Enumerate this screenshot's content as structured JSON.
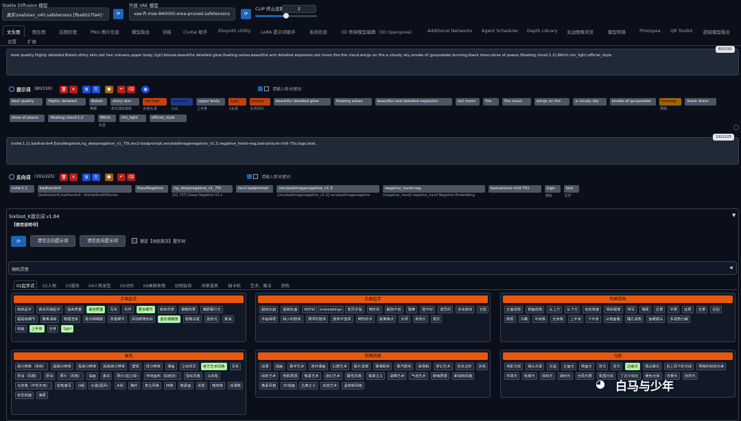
{
  "model": {
    "label": "Stable Diffusion 模型",
    "value": "真实\\realisian_v40.safetensors [fba9027fa4]",
    "vae_label": "外挂 VAE 模型",
    "vae_value": "vae-ft-mse-840000-ema-pruned.safetensors",
    "clip_label": "CLIP 终止层数",
    "clip_value": "2",
    "clip_level": 0.5
  },
  "tabs_row1": [
    "文生图",
    "图生图",
    "后期处理",
    "PNG 图片信息",
    "模型融合",
    "训练",
    "Civitai 助手",
    "Ebsynth Utility",
    "LoRA 提示词助手",
    "系统信息",
    "3D 骨架模型编辑（3D Openpose）",
    "Additional Networks",
    "Agent Scheduler",
    "Depth Library",
    "无边图像浏览",
    "模型转换",
    "Photopea",
    "QR Toolkit",
    "超级模型融合"
  ],
  "tabs_row2": [
    "设置",
    "扩展"
  ],
  "positive": {
    "text": "best quality,Highly detailed,Bokeh,shiny skin,red hair,volcano,upper body,1girl,blouse,beautiful detailed glow,floating ashes,beautiful and detailed explosion,red moon,fire,fire cloud,wings on fire,a cloudy sky,smoke of gunpowder,burning,black dress,dove of peace,(floating cloud:1.2),Witch,rim_light,official_style,",
    "counter": "80/150",
    "label": "提示词",
    "count": "(80/150)",
    "input_placeholder": "请输入新关键词",
    "chips": [
      {
        "t": "best quality",
        "s": ""
      },
      {
        "t": "Highly detailed",
        "s": ""
      },
      {
        "t": "Bokeh",
        "s": "焦散"
      },
      {
        "t": "shiny skin",
        "s": "有光泽的皮肤"
      },
      {
        "t": "red hair",
        "s": "红色头发"
      },
      {
        "t": "volcano",
        "s": "火山"
      },
      {
        "t": "upper body",
        "s": "上半身"
      },
      {
        "t": "1girl",
        "s": "1女孩"
      },
      {
        "t": "blouse",
        "s": "女式衬衫"
      },
      {
        "t": "beautiful detailed glow",
        "s": ""
      },
      {
        "t": "floating ashes",
        "s": ""
      },
      {
        "t": "beautiful and detailed explosion",
        "s": ""
      },
      {
        "t": "red moon",
        "s": ""
      },
      {
        "t": "fire",
        "s": ""
      },
      {
        "t": "fire cloud",
        "s": ""
      },
      {
        "t": "wings on fire",
        "s": ""
      },
      {
        "t": "a cloudy sky",
        "s": ""
      },
      {
        "t": "smoke of gunpowder",
        "s": ""
      },
      {
        "t": "burning",
        "s": "燃烧"
      },
      {
        "t": "black dress",
        "s": ""
      },
      {
        "t": "dove of peace",
        "s": ""
      },
      {
        "t": "floating cloud:1.2",
        "s": ""
      },
      {
        "t": "Witch",
        "s": "女巫"
      },
      {
        "t": "rim_light",
        "s": ""
      },
      {
        "t": "official_style",
        "s": ""
      }
    ]
  },
  "negative": {
    "text": "(nsfw:1.1),badhandv4,EasyNegative,ng_deepnegative_v1_75t,rev2-badprompt,verybadimagenegative_v1.3,negative_hand-neg,bad-picture-chill-75v,logo,text,",
    "counter": "191/225",
    "label": "反向词",
    "count": "(191/225)",
    "input_placeholder": "请输入新关键词",
    "chips": [
      {
        "t": "nsfw:1.1",
        "s": ""
      },
      {
        "t": "badhandv4",
        "s": "[badhandv4] badhandv4 - AnimeIllustDiffusion"
      },
      {
        "t": "EasyNegative",
        "s": ""
      },
      {
        "t": "ng_deepnegative_v1_75t",
        "s": "[V1.75T] Deep Negative V1.x"
      },
      {
        "t": "rev2-badprompt",
        "s": ""
      },
      {
        "t": "verybadimagenegative_v1.3",
        "s": "[verybadimagenegative_v1.3] verybadimagenegative"
      },
      {
        "t": "negative_hand-neg",
        "s": "[negative_hand] negative_hand Negative Embedding"
      },
      {
        "t": "bad-picture-chill-75v",
        "s": ""
      },
      {
        "t": "logo",
        "s": "商标"
      },
      {
        "t": "text",
        "s": "文字"
      }
    ]
  },
  "sixgod": {
    "title": "SixGod_K提示词 v1.64",
    "help": "【使用说明书】",
    "clear_pos": "清空正向提示词",
    "clear_neg": "清空反向提示词",
    "lock_label": "锁定【动态批次】提示词",
    "random_label": "随机灵感",
    "subtabs": [
      "01起手式",
      "02人物",
      "03服饰",
      "04人物发型",
      "05动作",
      "06画面表情",
      "动物装饰",
      "场景道具",
      "抽卡机",
      "艺术、魔法",
      "颜色"
    ],
    "groups": [
      {
        "title": "正面起手",
        "items": [
          "简单起手",
          "真实风格起手",
          "提高质量",
          "最佳质量",
          "写实",
          "杰作",
          "更多细节",
          "简单背景",
          "模糊背景",
          "满屏幕灯光",
          "超超级细节",
          "聚焦清晰",
          "物理渲染",
          "极详细细腻",
          "改善细节",
          "添加鲜艳色彩",
          "虚化模糊景",
          "粗略设置",
          "金粉光",
          "紫油",
          "绘画",
          "上半身",
          "全身",
          "1girl"
        ]
      },
      {
        "title": "负面起手",
        "items": [
          "超级负面",
          "基础负面",
          "NSFW",
          "embeddings",
          "变异手指",
          "畸形的",
          "解剖不良",
          "警察",
          "脸不好",
          "变异的",
          "多余肢体",
          "丑陋",
          "手画得很",
          "缺少的肢体",
          "漂浮的肢体",
          "肢体不连贯",
          "畸形的手",
          "脱离焦点",
          "长颈",
          "身体长",
          "变形"
        ]
      },
      {
        "title": "构图视角",
        "items": [
          "正面视角",
          "侧面视角",
          "从上方",
          "从下方",
          "动态角度",
          "倾斜视角",
          "特写",
          "微距",
          "近景",
          "中景",
          "远景",
          "全景",
          "近拍",
          "俯视",
          "鸟瞰",
          "半身像",
          "全身像",
          "上半身",
          "下半身",
          "从侧面看",
          "瞳孔视角",
          "鱼眼镜头",
          "多视角分解"
        ]
      },
      {
        "title": "画风",
        "items": [
          "高分辨率（常用）",
          "超高分辨率",
          "极高分辨率",
          "超高高分辨率",
          "壁纸",
          "低分辨率",
          "漫画",
          "立绘样式",
          "官方艺术风格",
          "写实",
          "厚涂（风格）",
          "厚涂",
          "照片（风格）",
          "油画",
          "真实",
          "照片(拍立得)",
          "传统画布（如纸张）",
          "签绘风格",
          "马克笔",
          "马克笔（中性灰色）",
          "铅笔速写",
          "Q版",
          "水墨(国风)",
          "水彩",
          "胸衬",
          "复古风格",
          "四格",
          "像素画",
          "彩影",
          "暗夜像",
          "动漫像",
          "杂志封面",
          "海报"
        ]
      },
      {
        "title": "构图风格",
        "items": [
          "动漫",
          "插画",
          "数字艺术",
          "连环漫画",
          "幻想艺术",
          "胶片滤镜",
          "赛博朋克",
          "蒸汽朋克",
          "高饱和",
          "梦幻艺术",
          "低多边形",
          "折纸",
          "线条艺术",
          "电影质感",
          "像素艺术",
          "迷幻艺术",
          "酸性风格",
          "极简主义",
          "故障艺术",
          "气泡艺术",
          "玻璃质感",
          "新拟物风格",
          "像素风格",
          "3D插画",
          "古典主义",
          "动态艺术",
          "孟菲斯风格"
        ]
      },
      {
        "title": "光影",
        "items": [
          "电影光效",
          "镜头光晕",
          "光追",
          "正面光",
          "侧面光",
          "背光",
          "逆光",
          "边缘光",
          "强边缘光",
          "自上而下的光线",
          "明亮的射线光束",
          "环境光",
          "轮廓光",
          "体积光",
          "漫射光",
          "全局光照",
          "氛围光效",
          "丁达尔效应",
          "暖色光效",
          "背景光",
          "自然光"
        ]
      }
    ]
  },
  "watermark": "白马与少年"
}
